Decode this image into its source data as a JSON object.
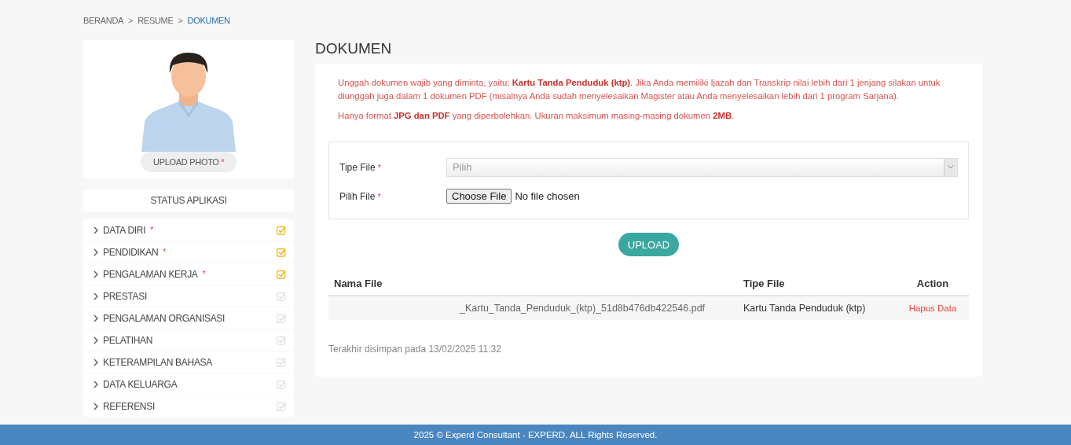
{
  "breadcrumb": [
    {
      "label": "BERANDA",
      "selected": false
    },
    {
      "label": "RESUME",
      "selected": false
    },
    {
      "label": "DOKUMEN",
      "selected": true
    }
  ],
  "breadcrumb_separator": ">",
  "profile": {
    "upload_button": "UPLOAD PHOTO",
    "mark": "*"
  },
  "status_title": "STATUS APLIKASI",
  "sidebar": {
    "items": [
      {
        "label": "DATA DIRI",
        "mark": "*",
        "checked": true
      },
      {
        "label": "PENDIDIKAN",
        "mark": "*",
        "checked": true
      },
      {
        "label": "PENGALAMAN KERJA",
        "mark": "*",
        "checked": true
      },
      {
        "label": "PRESTASI",
        "checked": false
      },
      {
        "label": "PENGALAMAN ORGANISASI",
        "checked": false
      },
      {
        "label": "PELATIHAN",
        "checked": false
      },
      {
        "label": "KETERAMPILAN BAHASA",
        "checked": false
      },
      {
        "label": "DATA KELUARGA",
        "checked": false
      },
      {
        "label": "REFERENSI",
        "checked": false
      }
    ]
  },
  "page_title": "DOKUMEN",
  "notices": [
    "Unggah dokumen wajib yang diminta, yaitu: **Kartu Tanda Penduduk (ktp)**. Jika Anda memiliki Ijazah dan Transkrip nilai lebih dari 1 jenjang silakan untuk diunggah juga dalam 1 dokumen PDF (misalnya Anda sudah menyelesaikan Magister atau Anda menyelesaikan lebih dari 1 program Sarjana).",
    "Hanya format **JPG dan PDF** yang diperbolehkan. Ukuran maksimum masing-masing dokumen **2MB**."
  ],
  "form": {
    "type_label": "Tipe File",
    "type_mark": "*",
    "type_value": "Pilih",
    "file_label": "Pilih File",
    "file_mark": "*",
    "file_button": "Choose File",
    "file_status": "No file chosen"
  },
  "upload_button": "UPLOAD",
  "table": {
    "columns": [
      "Nama File",
      "Tipe File",
      "Action"
    ],
    "rows": [
      {
        "name": "_Kartu_Tanda_Penduduk_(ktp)_51d8b476db422546.pdf",
        "type": "Kartu Tanda Penduduk (ktp)",
        "action": "Hapus Data"
      }
    ]
  },
  "saved_note": "Terakhir disimpan pada 13/02/2025 11:32",
  "footer": "2025 © Experd Consultant - EXPERD. ALL Rights Reserved."
}
